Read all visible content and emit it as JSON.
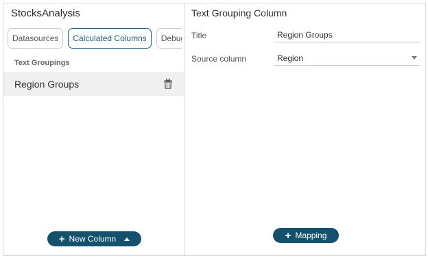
{
  "app": {
    "title": "StocksAnalysis"
  },
  "tabs": [
    {
      "label": "Datasources"
    },
    {
      "label": "Calculated Columns"
    },
    {
      "label": "Debug"
    }
  ],
  "sidebar": {
    "section_label": "Text Groupings",
    "items": [
      {
        "label": "Region Groups"
      }
    ],
    "new_column_label": "New Column"
  },
  "editor": {
    "panel_title": "Text Grouping Column",
    "title_field": {
      "label": "Title",
      "value": "Region Groups"
    },
    "source_field": {
      "label": "Source column",
      "value": "Region"
    },
    "mapping_label": "Mapping"
  },
  "colors": {
    "accent": "#14516d",
    "selected_bg": "#f0f0f0",
    "border": "#d9d9d9"
  },
  "icons": [
    "trash-icon",
    "plus-icon",
    "caret-up-icon",
    "dropdown-caret-icon"
  ]
}
